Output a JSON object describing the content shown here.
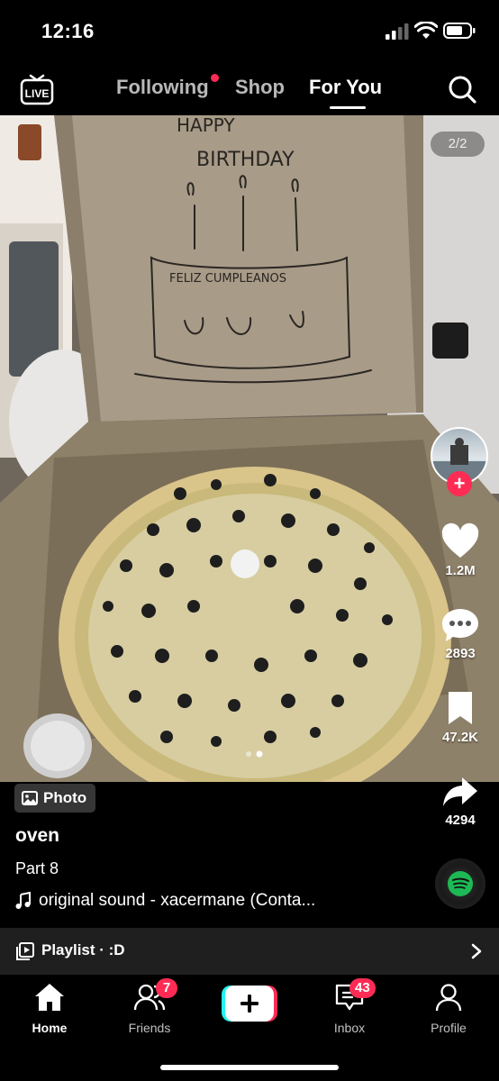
{
  "status_bar": {
    "time": "12:16"
  },
  "top_nav": {
    "live_label": "LIVE",
    "tabs": [
      {
        "label": "Following",
        "has_dot": true
      },
      {
        "label": "Shop"
      },
      {
        "label": "For You",
        "active": true
      }
    ]
  },
  "photo": {
    "counter": "2/2",
    "box_writing": [
      "HAPPY",
      "BIRTHDAY",
      "FELIZ CUMPLEANOS"
    ],
    "current_index": 2,
    "total": 2
  },
  "rail": {
    "likes": "1.2M",
    "comments": "2893",
    "saves": "47.2K",
    "shares": "4294"
  },
  "caption": {
    "badge": "Photo",
    "author": "oven",
    "description": "Part 8",
    "sound": "original sound - xacermane (Conta..."
  },
  "playlist": {
    "label": "Playlist · :D"
  },
  "bottom_nav": {
    "home": "Home",
    "friends": "Friends",
    "friends_badge": "7",
    "inbox": "Inbox",
    "inbox_badge": "43",
    "profile": "Profile"
  },
  "colors": {
    "accent": "#fe2c55",
    "create_cyan": "#25f4ee",
    "background": "#000000"
  }
}
